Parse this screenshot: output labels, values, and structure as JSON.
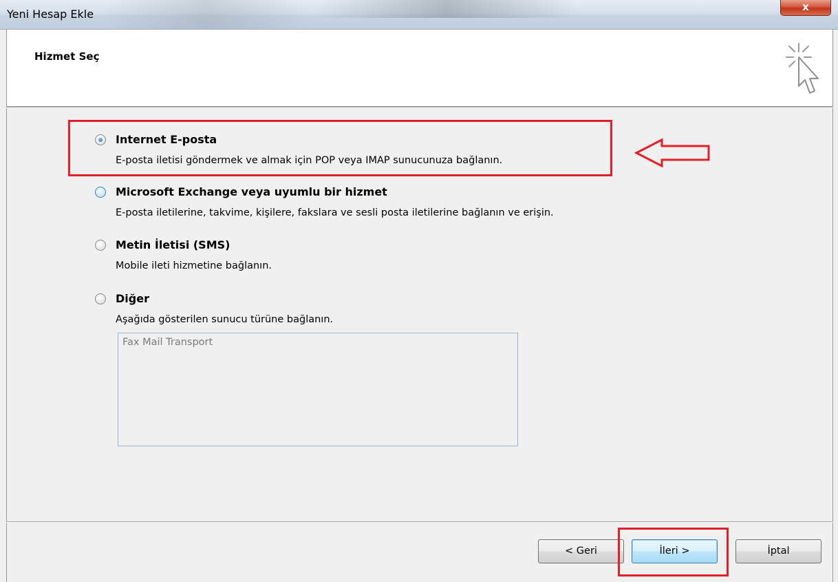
{
  "window": {
    "title": "Yeni Hesap Ekle",
    "close_label": "x"
  },
  "header": {
    "title": "Hizmet Seç",
    "icon": "pointer-cursor-sparkle-icon"
  },
  "options": [
    {
      "label": "Internet E-posta",
      "description": "E-posta iletisi göndermek ve almak için POP veya IMAP sunucunuza bağlanın.",
      "selected": true
    },
    {
      "label": "Microsoft Exchange veya uyumlu bir hizmet",
      "description": "E-posta iletilerine, takvime, kişilere, fakslara ve sesli posta iletilerine bağlanın ve erişin.",
      "selected": false
    },
    {
      "label": "Metin İletisi (SMS)",
      "description": "Mobile ileti hizmetine bağlanın.",
      "selected": false
    },
    {
      "label": "Diğer",
      "description": "Aşağıda gösterilen sunucu türüne bağlanın.",
      "selected": false
    }
  ],
  "server_list": {
    "items": [
      "Fax Mail Transport"
    ]
  },
  "buttons": {
    "back": "< Geri",
    "next": "İleri >",
    "cancel": "İptal"
  },
  "annotation": {
    "color": "#e3202a"
  }
}
